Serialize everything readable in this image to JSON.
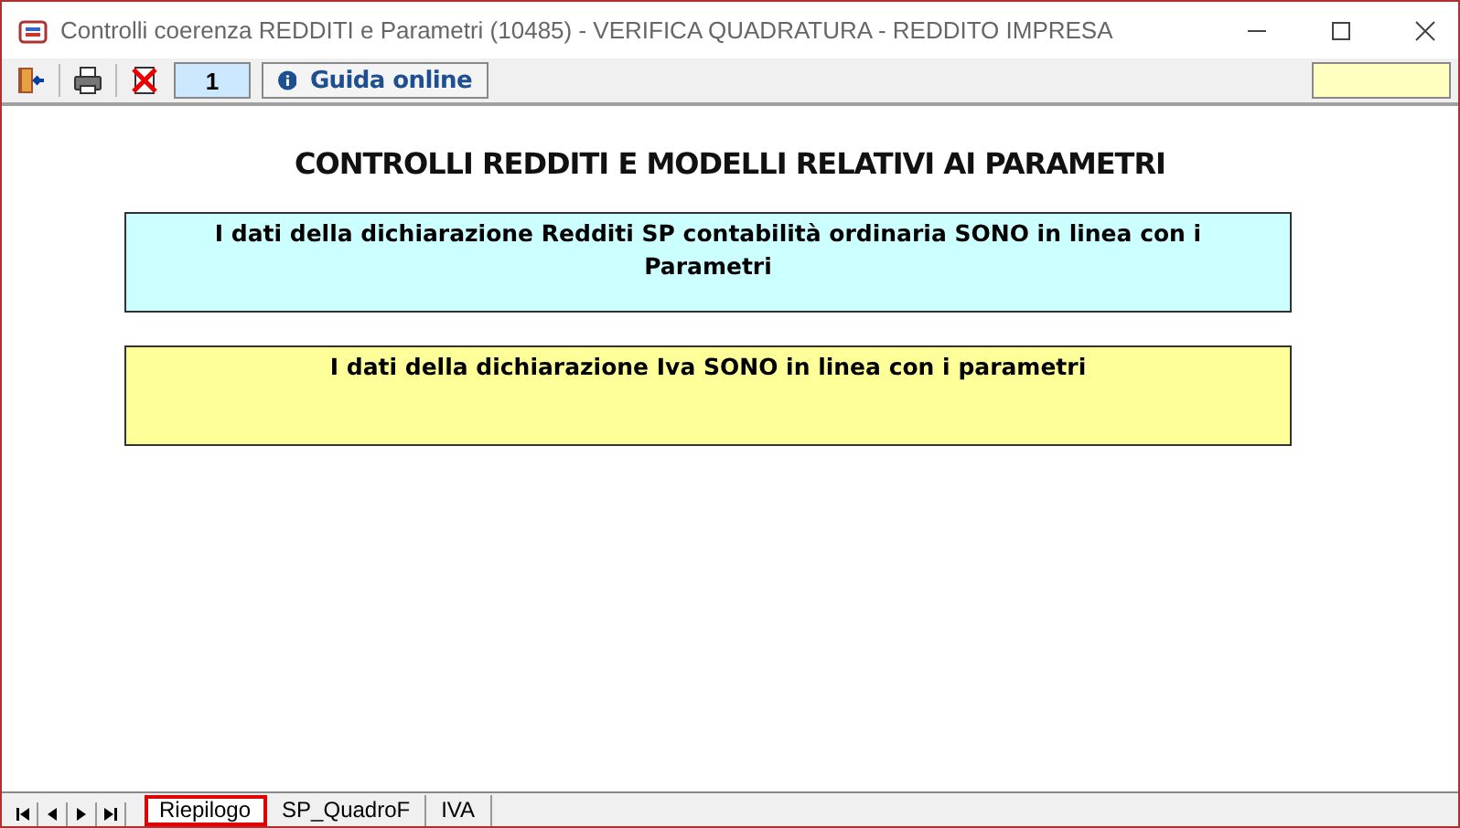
{
  "window": {
    "title": "Controlli coerenza REDDITI e Parametri (10485) - VERIFICA QUADRATURA - REDDITO IMPRESA"
  },
  "toolbar": {
    "page_number": "1",
    "help_button": "Guida online"
  },
  "heading": "CONTROLLI REDDITI E MODELLI RELATIVI AI PARAMETRI",
  "messages": [
    {
      "text": "I dati della dichiarazione Redditi SP contabilità ordinaria SONO in linea con i Parametri",
      "color": "#ccffff"
    },
    {
      "text": "I dati della dichiarazione Iva SONO in linea con i parametri",
      "color": "#ffff99"
    }
  ],
  "sheet_tabs": [
    {
      "label": "Riepilogo",
      "selected": true
    },
    {
      "label": "SP_QuadroF",
      "selected": false
    },
    {
      "label": "IVA",
      "selected": false
    }
  ]
}
